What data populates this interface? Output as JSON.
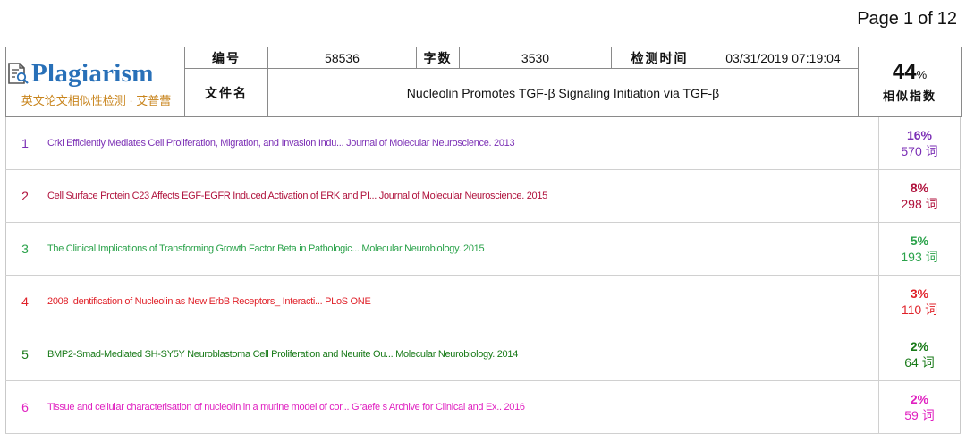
{
  "page": {
    "label": "Page",
    "current": "1",
    "of_label": "of",
    "total": "12"
  },
  "logo": {
    "name": "Plagiarism",
    "subtitle": "英文论文相似性检测 · 艾普蕾"
  },
  "meta": {
    "id_label": "编号",
    "id_value": "58536",
    "count_label": "字数",
    "count_value": "3530",
    "time_label": "检测时间",
    "time_value": "03/31/2019 07:19:04",
    "file_label": "文件名",
    "file_value": "Nucleolin Promotes TGF-β Signaling Initiation via TGF-β"
  },
  "score": {
    "value": "44",
    "unit": "%",
    "label": "相似指数"
  },
  "results": [
    {
      "index": "1",
      "title": "Crkl Efficiently Mediates Cell Proliferation, Migration, and Invasion Indu... Journal of Molecular Neuroscience. 2013",
      "percent": "16%",
      "words": "570 词",
      "color": "#7b2fb5"
    },
    {
      "index": "2",
      "title": "Cell Surface Protein C23 Affects EGF-EGFR Induced Activation of ERK and PI... Journal of Molecular Neuroscience. 2015",
      "percent": "8%",
      "words": "298 词",
      "color": "#b0123c"
    },
    {
      "index": "3",
      "title": "The Clinical Implications of Transforming Growth Factor Beta in Pathologic... Molecular Neurobiology. 2015",
      "percent": "5%",
      "words": "193 词",
      "color": "#2aa24a"
    },
    {
      "index": "4",
      "title": "2008 Identification of Nucleolin as New ErbB Receptors_ Interacti... PLoS ONE",
      "percent": "3%",
      "words": "110 词",
      "color": "#e0222a"
    },
    {
      "index": "5",
      "title": "BMP2-Smad-Mediated SH-SY5Y Neuroblastoma Cell Proliferation and Neurite Ou... Molecular Neurobiology. 2014",
      "percent": "2%",
      "words": "64 词",
      "color": "#187a18"
    },
    {
      "index": "6",
      "title": "Tissue and cellular characterisation of nucleolin in a murine model of cor... Graefe s Archive for Clinical and Ex.. 2016",
      "percent": "2%",
      "words": "59 词",
      "color": "#e020c0"
    }
  ]
}
